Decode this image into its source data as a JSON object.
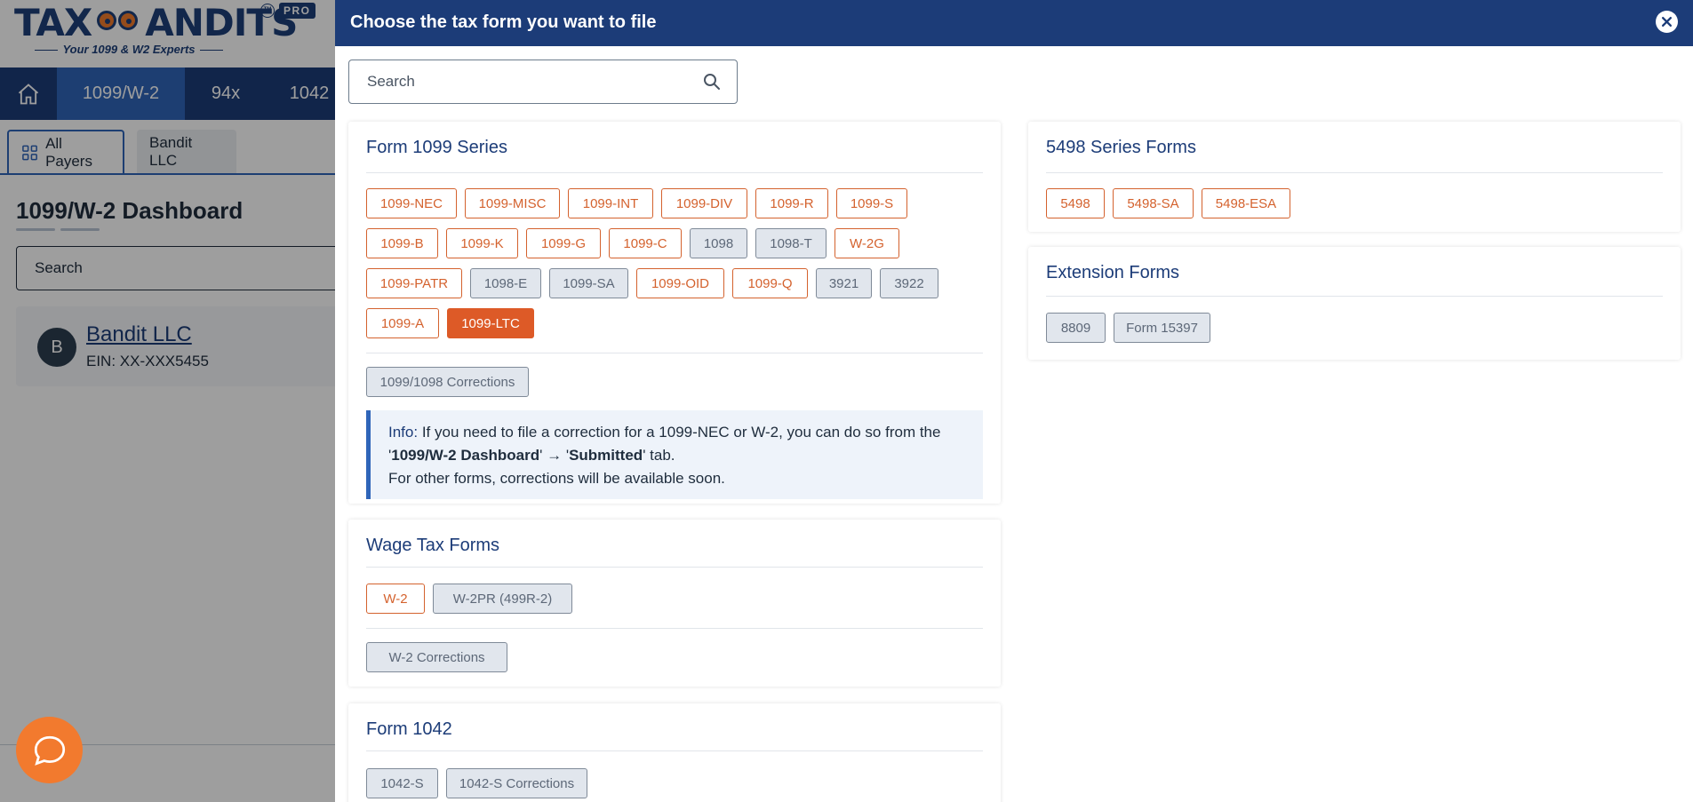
{
  "app": {
    "logo_text_left": "TAX",
    "logo_text_right": "ANDITS",
    "logo_tm": "TM",
    "logo_pro": "PRO",
    "logo_tagline": "Your 1099 & W2 Experts",
    "nav_tabs": [
      "1099/W-2",
      "94x",
      "1042"
    ],
    "payer_tabs": [
      "All Payers",
      "Bandit LLC"
    ],
    "dashboard_title": "1099/W-2 Dashboard",
    "search_placeholder": "Search",
    "payer": {
      "avatar": "B",
      "name": "Bandit LLC",
      "ein": "EIN: XX-XXX5455"
    }
  },
  "drawer": {
    "title": "Choose the tax form you want to file",
    "search_placeholder": "Search",
    "series_1099": {
      "title": "Form 1099 Series",
      "rows": [
        [
          "1099-NEC",
          "1099-MISC",
          "1099-INT",
          "1099-DIV",
          "1099-R",
          "1099-S"
        ],
        [
          "1099-B",
          "1099-K",
          "1099-G",
          "1099-C",
          "1098",
          "1098-T",
          "W-2G"
        ],
        [
          "1099-PATR",
          "1098-E",
          "1099-SA",
          "1099-OID",
          "1099-Q",
          "3921",
          "3922"
        ],
        [
          "1099-A",
          "1099-LTC"
        ]
      ],
      "corrections": "1099/1098 Corrections",
      "info_label": "Info:",
      "info_line1": " If you need to file a correction for a 1099-NEC or W-2, you can do so from the",
      "info_q1": "'",
      "info_bold1": "1099/W-2 Dashboard",
      "info_arrow": "' → '",
      "info_bold2": "Submitted",
      "info_tail": "' tab.",
      "info_line3": "For other forms, corrections will be available soon."
    },
    "wage_tax": {
      "title": "Wage Tax Forms",
      "forms": [
        "W-2",
        "W-2PR (499R-2)"
      ],
      "corrections": "W-2 Corrections"
    },
    "form_1042": {
      "title": "Form 1042",
      "forms": [
        "1042-S",
        "1042-S Corrections"
      ]
    },
    "series_5498": {
      "title": "5498 Series Forms",
      "forms": [
        "5498",
        "5498-SA",
        "5498-ESA"
      ]
    },
    "extension": {
      "title": "Extension Forms",
      "forms": [
        "8809",
        "Form 15397"
      ]
    }
  },
  "colors": {
    "header_navy": "#1c3c78",
    "active_tab_blue": "#2f65b9",
    "chip_orange": "#d4622e",
    "chip_selected": "#dd5a27",
    "chip_disabled": "#e1e6ed",
    "chat_orange": "#f27a2e"
  },
  "icons": {
    "home": "home-icon",
    "grid": "grid-icon",
    "search": "search-icon",
    "close": "close-icon",
    "chat": "chat-icon"
  }
}
